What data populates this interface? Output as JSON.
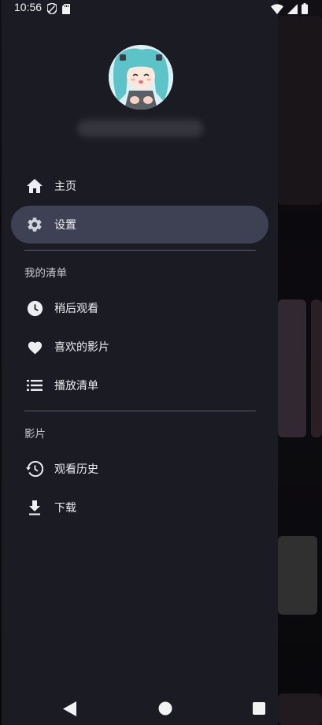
{
  "status_bar": {
    "time": "10:56",
    "left_icons": [
      "shield-icon",
      "sd-card-icon"
    ],
    "right_icons": [
      "wifi-icon",
      "signal-icon",
      "battery-icon"
    ]
  },
  "drawer": {
    "primary_items": [
      {
        "label": "主页",
        "icon": "home-icon"
      },
      {
        "label": "设置",
        "icon": "gear-icon",
        "active": true
      }
    ],
    "sections": [
      {
        "title": "我的清单",
        "items": [
          {
            "label": "稍后观看",
            "icon": "clock-icon"
          },
          {
            "label": "喜欢的影片",
            "icon": "heart-icon"
          },
          {
            "label": "播放清单",
            "icon": "playlist-icon"
          }
        ]
      },
      {
        "title": "影片",
        "items": [
          {
            "label": "观看历史",
            "icon": "history-icon"
          },
          {
            "label": "下载",
            "icon": "download-icon"
          }
        ]
      }
    ]
  },
  "colors": {
    "drawer_bg": "#1b1c23",
    "active_item_bg": "#3e4153",
    "text": "#eceef2"
  },
  "nav_bar": [
    "back-icon",
    "home-circle-icon",
    "recents-icon"
  ]
}
